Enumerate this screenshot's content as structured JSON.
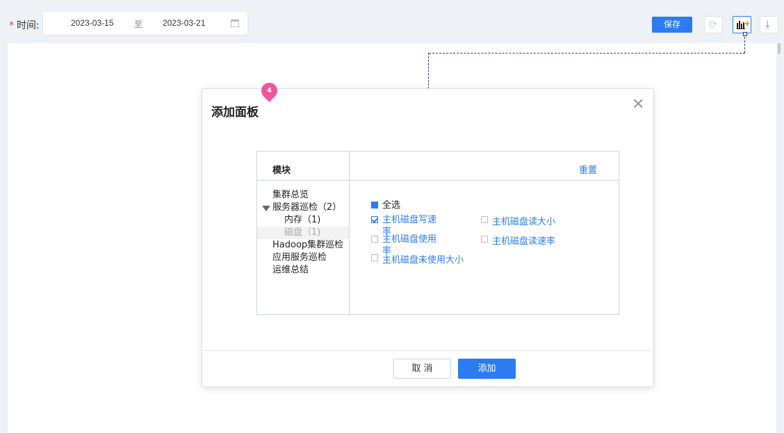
{
  "filter": {
    "time_label": "时间:",
    "required_mark": "*",
    "start_date": "2023-03-15",
    "separator": "至",
    "end_date": "2023-03-21"
  },
  "toolbar": {
    "save_label": "保存"
  },
  "pin": {
    "number": "4"
  },
  "modal": {
    "title": "添加面板",
    "column_header": "模块",
    "reset_label": "重置",
    "tree": [
      {
        "label": "集群总览"
      },
      {
        "label": "服务器巡检（2）",
        "expanded": true
      },
      {
        "label": "内存（1)"
      },
      {
        "label": "磁盘（1)",
        "selected": true
      },
      {
        "label": "Hadoop集群巡检"
      },
      {
        "label": "应用服务巡检"
      },
      {
        "label": "运维总结"
      }
    ],
    "select_all": "全选",
    "options": [
      {
        "label": "主机磁盘写速率",
        "checked": true
      },
      {
        "label": "主机磁盘读大小",
        "checked": false
      },
      {
        "label": "主机磁盘使用率",
        "checked": false
      },
      {
        "label": "主机磁盘读速率",
        "checked": false
      },
      {
        "label": "主机磁盘未使用大小",
        "checked": false
      }
    ],
    "cancel_label": "取 消",
    "add_label": "添加"
  },
  "colors": {
    "accent": "#2b7cf0",
    "pin": "#f0569e",
    "connector": "#1a3aa8"
  }
}
